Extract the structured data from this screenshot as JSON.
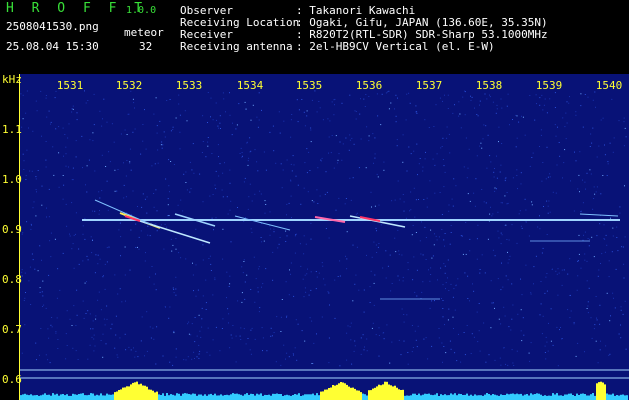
{
  "header": {
    "app_name": "H R O F F T",
    "version": "1.0.0",
    "filename": "2508041530.png",
    "meteor_label": "meteor",
    "datetime": "25.08.04 15:30",
    "meteor_count": "32",
    "info_labels": [
      "Observer",
      "Receiving Location",
      "Receiver",
      "Receiving antenna"
    ],
    "info_values": [
      ": Takanori Kawachi",
      ": Ogaki, Gifu, JAPAN (136.60E, 35.35N)",
      ": R820T2(RTL-SDR) SDR-Sharp 53.1000MHz",
      ": 2el-HB9CV Vertical (el. E-W)"
    ]
  },
  "spectrogram": {
    "y_unit": "kHz",
    "x_ticks": [
      "1531",
      "1532",
      "1533",
      "1534",
      "1535",
      "1536",
      "1537",
      "1538",
      "1539",
      "1540"
    ],
    "y_ticks": [
      "1.1",
      "1.0",
      "0.9",
      "0.8",
      "0.7",
      "0.6"
    ],
    "colors": {
      "background": "#081277",
      "axis": "#ffff33",
      "carrier": "#a8d8ff",
      "level_bar": "#33ccff",
      "level_peak": "#ffff33"
    }
  }
}
